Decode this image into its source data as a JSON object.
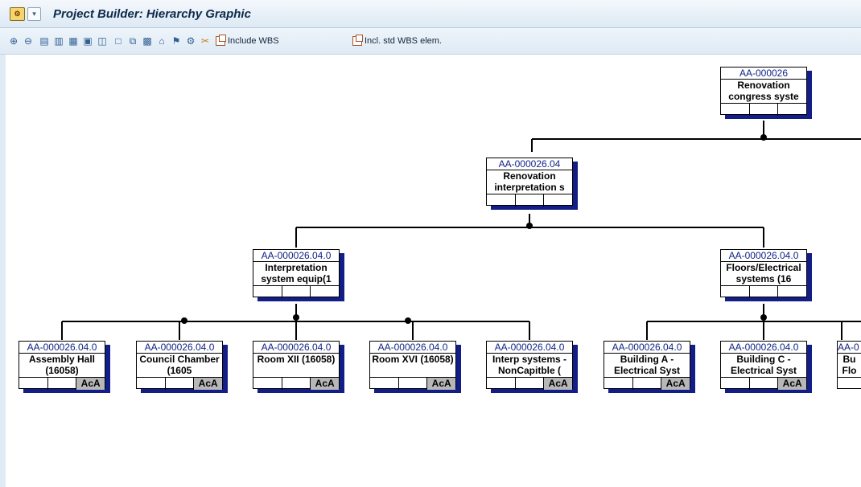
{
  "window": {
    "title": "Project Builder: Hierarchy Graphic"
  },
  "toolbar": {
    "icons": [
      "zoom-in-icon",
      "zoom-out-icon",
      "expand-icon",
      "collapse-icon",
      "options-icon",
      "overview-icon",
      "refresh-icon",
      "new-icon",
      "copy-icon",
      "save-icon",
      "delete-icon",
      "hierarchy-icon",
      "settings-icon",
      "cut-icon"
    ],
    "include_wbs": "Include WBS",
    "incl_std_wbs": "Incl. std WBS elem."
  },
  "nodes": {
    "root": {
      "id": "AA-000026",
      "desc": "Renovation congress syste",
      "status": ""
    },
    "l1": {
      "id": "AA-000026.04",
      "desc": "Renovation interpretation s",
      "status": ""
    },
    "l2a": {
      "id": "AA-000026.04.0",
      "desc": "Interpretation system equip(1",
      "status": ""
    },
    "l2b": {
      "id": "AA-000026.04.0",
      "desc": "Floors/Electrical systems (16",
      "status": ""
    },
    "l3": [
      {
        "id": "AA-000026.04.0",
        "desc": "Assembly Hall (16058)",
        "status": "AcA"
      },
      {
        "id": "AA-000026.04.0",
        "desc": "Council Chamber (1605",
        "status": "AcA"
      },
      {
        "id": "AA-000026.04.0",
        "desc": "Room XII (16058)",
        "status": "AcA"
      },
      {
        "id": "AA-000026.04.0",
        "desc": "Room XVI (16058)",
        "status": "AcA"
      },
      {
        "id": "AA-000026.04.0",
        "desc": "Interp systems -NonCapitble (",
        "status": "AcA"
      },
      {
        "id": "AA-000026.04.0",
        "desc": "Building A - Electrical Syst",
        "status": "AcA"
      },
      {
        "id": "AA-000026.04.0",
        "desc": "Building C - Electrical Syst",
        "status": "AcA"
      },
      {
        "id": "AA-0",
        "desc": "Bu Flo",
        "status": ""
      }
    ]
  }
}
